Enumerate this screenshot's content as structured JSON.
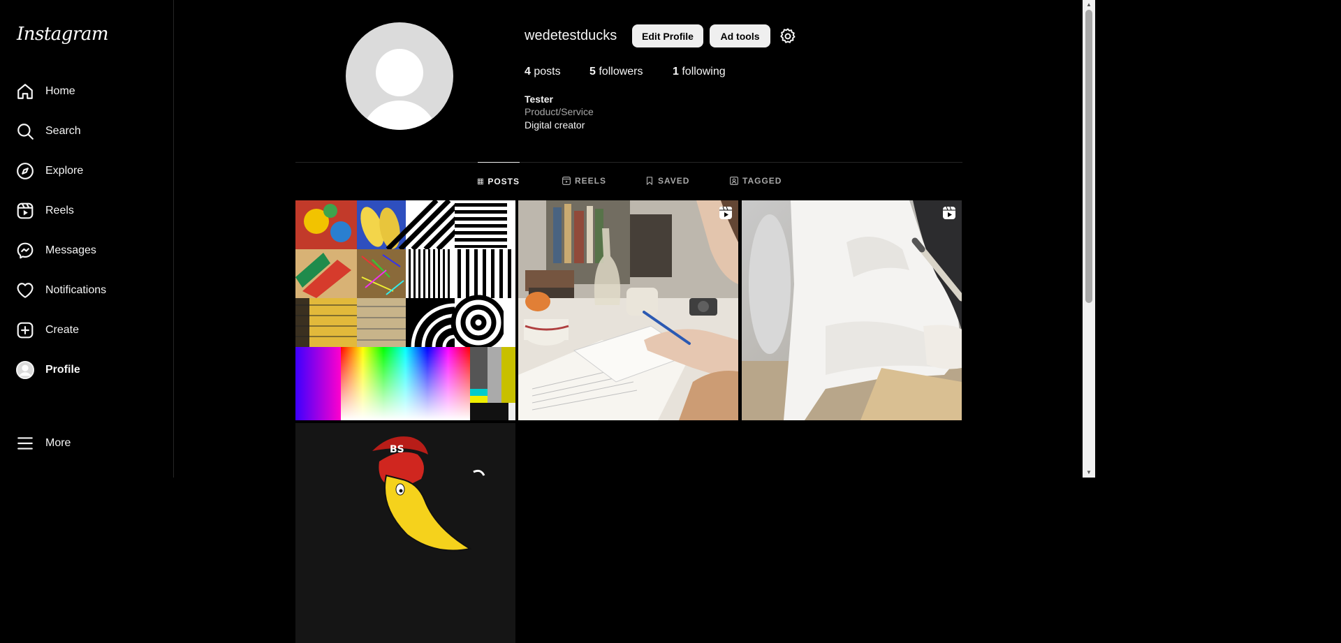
{
  "brand": {
    "logo_text": "Instagram"
  },
  "sidebar": {
    "items": [
      {
        "label": "Home",
        "icon": "home-icon"
      },
      {
        "label": "Search",
        "icon": "search-icon"
      },
      {
        "label": "Explore",
        "icon": "compass-icon"
      },
      {
        "label": "Reels",
        "icon": "reels-icon"
      },
      {
        "label": "Messages",
        "icon": "messenger-icon"
      },
      {
        "label": "Notifications",
        "icon": "heart-icon"
      },
      {
        "label": "Create",
        "icon": "plus-square-icon"
      },
      {
        "label": "Profile",
        "icon": "avatar-icon"
      }
    ],
    "more_label": "More"
  },
  "profile": {
    "username": "wedetestducks",
    "edit_label": "Edit Profile",
    "adtools_label": "Ad tools",
    "posts_count": "4",
    "posts_label": "posts",
    "followers_count": "5",
    "followers_label": "followers",
    "following_count": "1",
    "following_label": "following",
    "full_name": "Tester",
    "category": "Product/Service",
    "bio": "Digital creator"
  },
  "tabs": [
    {
      "label": "POSTS",
      "active": true
    },
    {
      "label": "REELS",
      "active": false
    },
    {
      "label": "SAVED",
      "active": false
    },
    {
      "label": "TAGGED",
      "active": false
    }
  ],
  "posts": [
    {
      "kind": "image",
      "description": "test-pattern-collage"
    },
    {
      "kind": "reel",
      "description": "person-writing-at-desk"
    },
    {
      "kind": "reel",
      "description": "person-in-white-shirt-with-pencil"
    },
    {
      "kind": "image",
      "description": "cartoon-banana-logo"
    }
  ],
  "colors": {
    "background": "#000000",
    "text": "#f5f5f5",
    "muted": "#a8a8a8",
    "button": "#efefef",
    "divider": "#262626"
  }
}
